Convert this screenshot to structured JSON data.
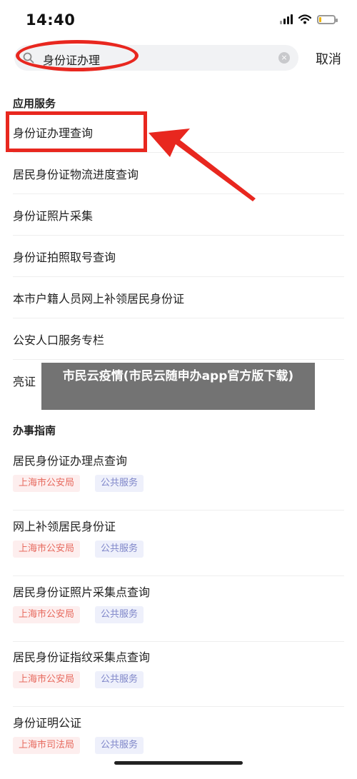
{
  "status": {
    "time": "14:40"
  },
  "search": {
    "query": "身份证办理",
    "cancel_label": "取消"
  },
  "services": {
    "title": "应用服务",
    "items": [
      "身份证办理查询",
      "居民身份证物流进度查询",
      "身份证照片采集",
      "身份证拍照取号查询",
      "本市户籍人员网上补领居民身份证",
      "公安人口服务专栏",
      "亮证"
    ]
  },
  "guide": {
    "title": "办事指南",
    "items": [
      {
        "title": "居民身份证办理点查询",
        "org": "上海市公安局",
        "type": "公共服务"
      },
      {
        "title": "网上补领居民身份证",
        "org": "上海市公安局",
        "type": "公共服务"
      },
      {
        "title": "居民身份证照片采集点查询",
        "org": "上海市公安局",
        "type": "公共服务"
      },
      {
        "title": "居民身份证指纹采集点查询",
        "org": "上海市公安局",
        "type": "公共服务"
      },
      {
        "title": "身份证明公证",
        "org": "上海市司法局",
        "type": "公共服务"
      }
    ]
  },
  "banner": {
    "text": "市民云疫情(市民云随申办app官方版下载)"
  },
  "colors": {
    "annotation": "#e8271f",
    "org_tag_text": "#e76a5e",
    "pub_tag_text": "#7f86c9"
  }
}
